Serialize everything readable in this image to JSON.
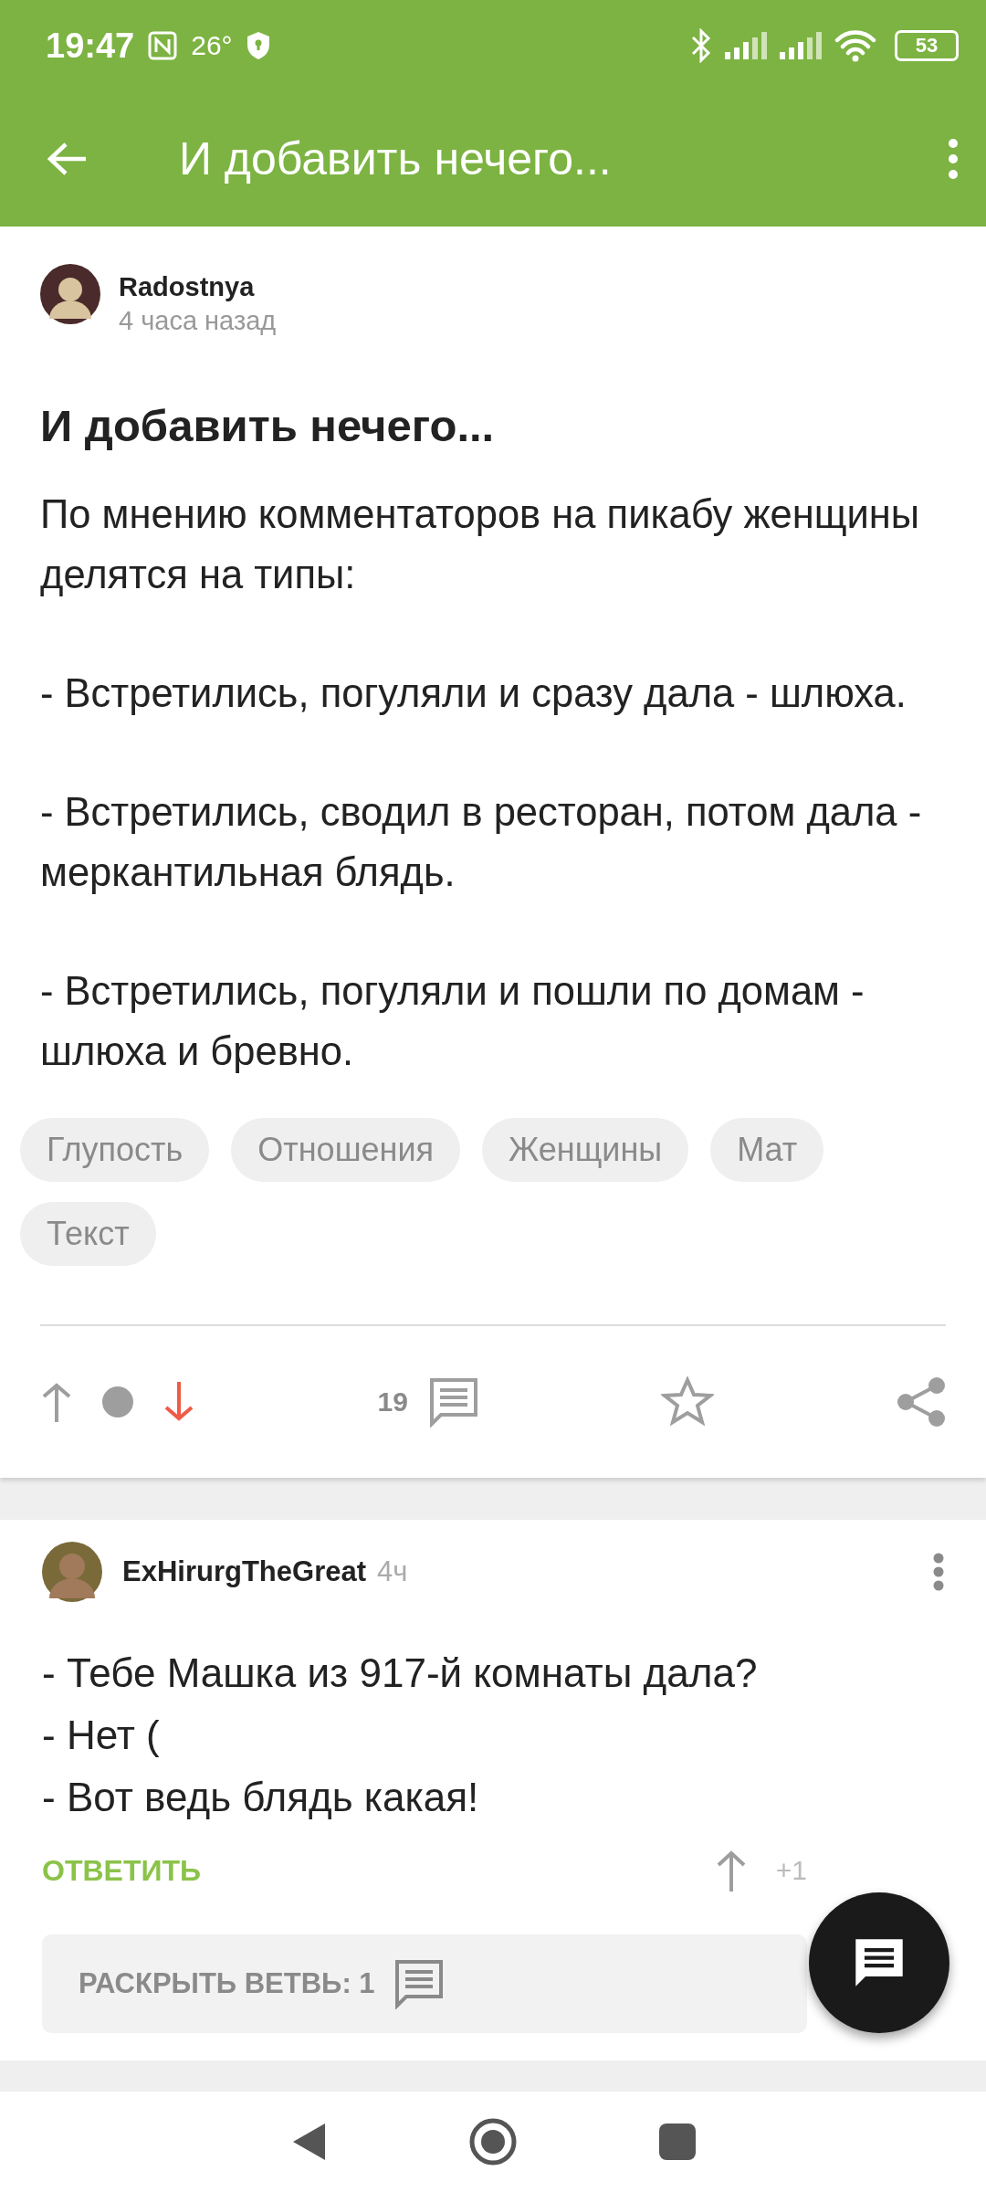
{
  "status_bar": {
    "time": "19:47",
    "temperature": "26°",
    "battery": "53"
  },
  "app_bar": {
    "title": "И добавить нечего..."
  },
  "post": {
    "author": "Radostnya",
    "time": "4 часа назад",
    "title": "И добавить нечего...",
    "paragraphs": [
      "По мнению комментаторов на пикабу женщины делятся на типы:",
      "- Встретились, погуляли и сразу дала - шлюха.",
      "- Встретились, сводил в ресторан, потом дала - меркантильная блядь.",
      "- Встретились, погуляли и пошли по домам - шлюха и бревно."
    ],
    "tags": [
      "Глупость",
      "Отношения",
      "Женщины",
      "Мат",
      "Текст"
    ],
    "upvoted": false,
    "downvoted": true,
    "comments_count": "19",
    "saved": false
  },
  "comment": {
    "author": "ExHirurgTheGreat",
    "time": "4ч",
    "lines": [
      "- Тебе Машка из 917-й комнаты дала?",
      "- Нет (",
      "- Вот ведь блядь какая!"
    ],
    "reply": "ОТВЕТИТЬ",
    "rating": "+1",
    "expand": "РАСКРЫТЬ ВЕТВЬ: 1"
  }
}
